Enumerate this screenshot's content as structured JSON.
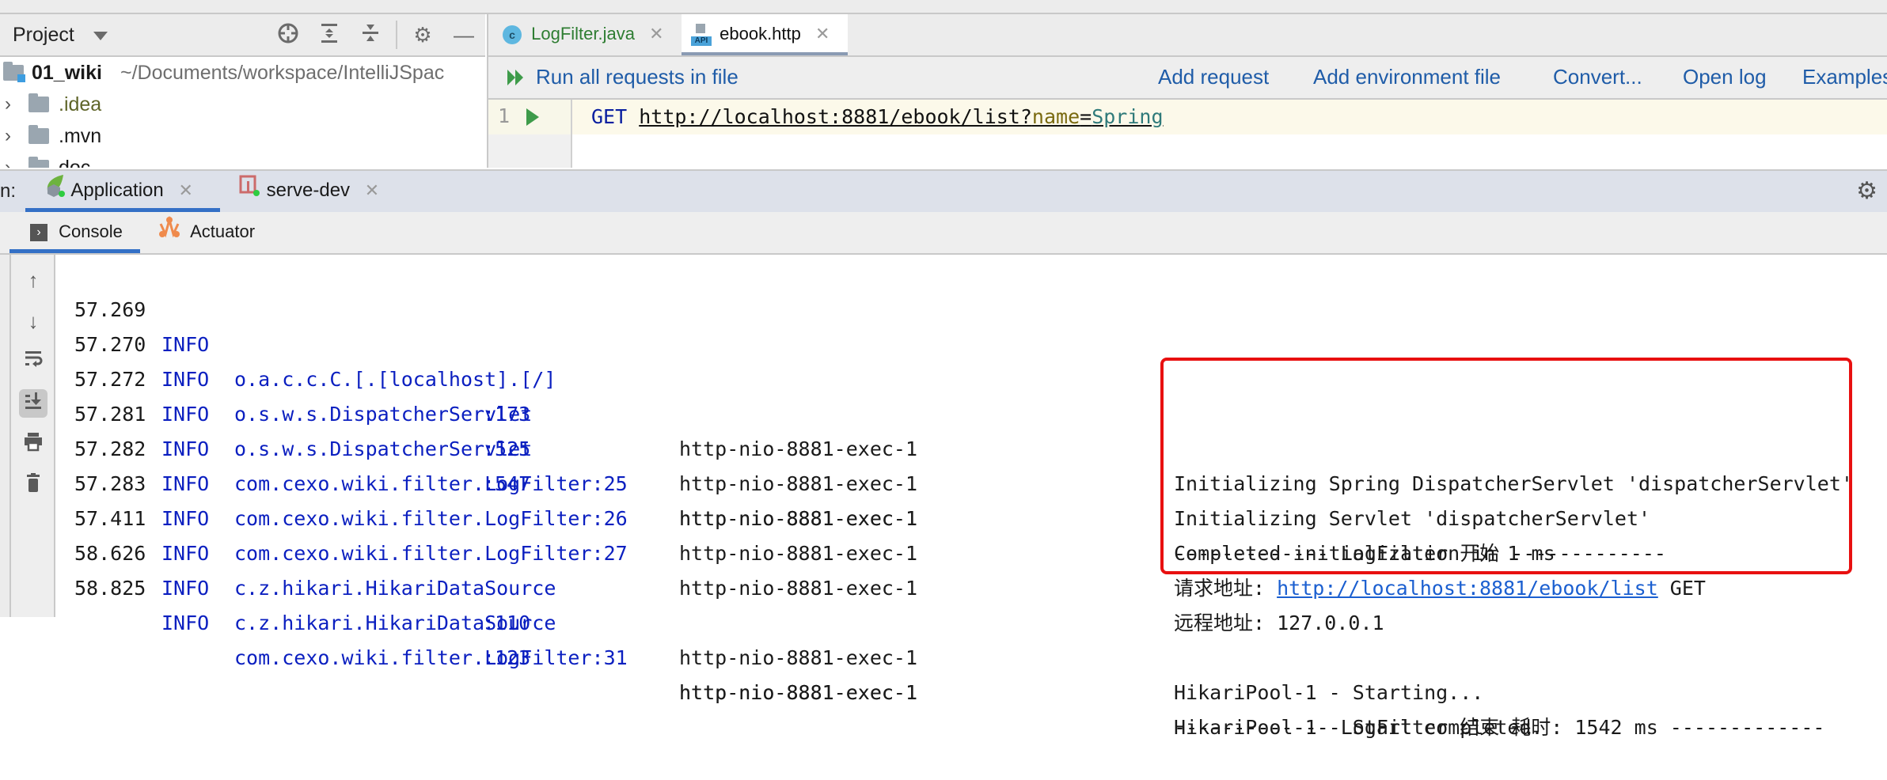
{
  "project_panel": {
    "title": "Project",
    "toolbar_icons": [
      "locate-icon",
      "expand-all-icon",
      "collapse-all-icon",
      "gear-icon",
      "minimize-icon"
    ],
    "tree": [
      {
        "name": "01_wiki",
        "path": "~/Documents/workspace/IntelliJSpac",
        "type": "module"
      },
      {
        "name": ".idea",
        "type": "folder"
      },
      {
        "name": ".mvn",
        "type": "folder"
      },
      {
        "name": "doc",
        "type": "folder"
      }
    ]
  },
  "editor": {
    "tabs": [
      {
        "label": "LogFilter.java",
        "icon": "java-class-icon",
        "active": false
      },
      {
        "label": "ebook.http",
        "icon": "api-file-icon",
        "active": true
      }
    ],
    "toolbar": {
      "run_all": "Run all requests in file",
      "add_request": "Add request",
      "add_env_file": "Add environment file",
      "convert": "Convert...",
      "open_log": "Open log",
      "examples": "Examples"
    },
    "lines": [
      {
        "number": "1",
        "method": "GET",
        "url_base": "http://localhost:8881/ebook/list?",
        "param_name": "name",
        "equals": "=",
        "param_value": "Spring"
      }
    ]
  },
  "run_window": {
    "prefix": "n:",
    "tabs": [
      {
        "label": "Application",
        "icon": "spring-boot-icon",
        "active": true
      },
      {
        "label": "serve-dev",
        "icon": "npm-icon",
        "active": false
      }
    ],
    "sub_tabs": [
      {
        "label": "Console",
        "icon": "console-icon",
        "active": true
      },
      {
        "label": "Actuator",
        "icon": "actuator-icon",
        "active": false
      }
    ],
    "side_tools": [
      "up-arrow-icon",
      "down-arrow-icon",
      "soft-wrap-icon",
      "scroll-to-end-icon",
      "print-icon",
      "trash-icon"
    ]
  },
  "console": {
    "colors": {
      "level": "#0b1fc0",
      "text": "#1a1a1a",
      "link": "#1b5fd0",
      "highlight": "#e81010"
    },
    "rows": [
      {
        "time": "57.269",
        "level": "INFO",
        "logger": "o.a.c.c.C.[.[localhost].[/]",
        "line": ":173",
        "thread": "http-nio-8881-exec-1",
        "message": "Initializing Spring DispatcherServlet 'dispatcherServlet'"
      },
      {
        "time": "57.270",
        "level": "INFO",
        "logger": "o.s.w.s.DispatcherServlet",
        "line": ":525",
        "thread": "http-nio-8881-exec-1",
        "message": "Initializing Servlet 'dispatcherServlet'"
      },
      {
        "time": "57.272",
        "level": "INFO",
        "logger": "o.s.w.s.DispatcherServlet",
        "line": ":547",
        "thread": "http-nio-8881-exec-1",
        "message": "Completed initialization in 1 ms"
      },
      {
        "time": "57.281",
        "level": "INFO",
        "logger": "com.cexo.wiki.filter.LogFilter:25",
        "line": "",
        "thread": "http-nio-8881-exec-1",
        "message": "------------- LogFilter 开始 -------------"
      },
      {
        "time": "57.282",
        "level": "INFO",
        "logger": "com.cexo.wiki.filter.LogFilter:26",
        "line": "",
        "thread": "http-nio-8881-exec-1",
        "message_prefix": "请求地址: ",
        "message_link": "http://localhost:8881/ebook/list",
        "message_suffix": " GET"
      },
      {
        "time": "57.283",
        "level": "INFO",
        "logger": "com.cexo.wiki.filter.LogFilter:27",
        "line": "",
        "thread": "http-nio-8881-exec-1",
        "message": "远程地址: 127.0.0.1"
      },
      {
        "time": "57.411",
        "level": "INFO",
        "logger": "c.z.hikari.HikariDataSource",
        "line": ":110",
        "thread": "http-nio-8881-exec-1",
        "message": "HikariPool-1 - Starting..."
      },
      {
        "time": "58.626",
        "level": "INFO",
        "logger": "c.z.hikari.HikariDataSource",
        "line": ":123",
        "thread": "http-nio-8881-exec-1",
        "message": "HikariPool-1 - Start completed."
      },
      {
        "time": "58.825",
        "level": "INFO",
        "logger": "com.cexo.wiki.filter.LogFilter:31",
        "line": "",
        "thread": "http-nio-8881-exec-1",
        "message": "------------- LogFilter 结束 耗时: 1542 ms -------------"
      }
    ]
  }
}
